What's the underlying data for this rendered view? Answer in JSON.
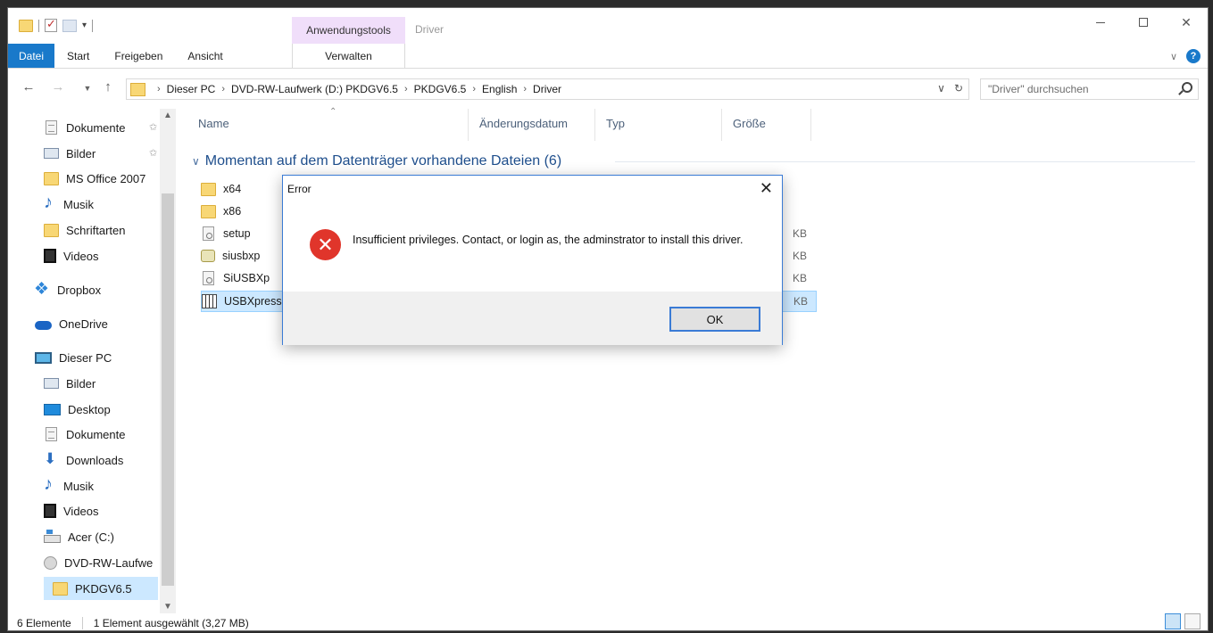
{
  "window": {
    "title": "Driver",
    "contextual_group": "Anwendungstools"
  },
  "ribbon": {
    "tabs": [
      "Datei",
      "Start",
      "Freigeben",
      "Ansicht"
    ],
    "context_tab": "Verwalten"
  },
  "address": {
    "crumbs": [
      "Dieser PC",
      "DVD-RW-Laufwerk (D:) PKDGV6.5",
      "PKDGV6.5",
      "English",
      "Driver"
    ]
  },
  "search": {
    "placeholder": "\"Driver\" durchsuchen"
  },
  "nav": {
    "items": [
      {
        "label": "Dokumente",
        "icon": "document-icon"
      },
      {
        "label": "Bilder",
        "icon": "pictures-icon"
      },
      {
        "label": "MS Office 2007",
        "icon": "folder-icon"
      },
      {
        "label": "Musik",
        "icon": "music-icon"
      },
      {
        "label": "Schriftarten",
        "icon": "folder-icon"
      },
      {
        "label": "Videos",
        "icon": "video-icon"
      },
      {
        "label": "Dropbox",
        "icon": "dropbox-icon"
      },
      {
        "label": "OneDrive",
        "icon": "onedrive-icon"
      },
      {
        "label": "Dieser PC",
        "icon": "pc-icon"
      },
      {
        "label": "Bilder",
        "icon": "pictures-icon"
      },
      {
        "label": "Desktop",
        "icon": "desktop-icon"
      },
      {
        "label": "Dokumente",
        "icon": "document-icon"
      },
      {
        "label": "Downloads",
        "icon": "download-icon"
      },
      {
        "label": "Musik",
        "icon": "music-icon"
      },
      {
        "label": "Videos",
        "icon": "video-icon"
      },
      {
        "label": "Acer (C:)",
        "icon": "drive-icon"
      },
      {
        "label": "DVD-RW-Laufwe",
        "icon": "disc-icon"
      },
      {
        "label": "PKDGV6.5",
        "icon": "folder-icon"
      }
    ]
  },
  "columns": [
    "Name",
    "Änderungsdatum",
    "Typ",
    "Größe"
  ],
  "group": {
    "label": "Momentan auf dem Datenträger vorhandene Dateien (6)"
  },
  "files": [
    {
      "name": "x64",
      "icon": "folder-icon",
      "size": ""
    },
    {
      "name": "x86",
      "icon": "folder-icon",
      "size": ""
    },
    {
      "name": "setup",
      "icon": "setup-file-icon",
      "size": "KB"
    },
    {
      "name": "siusbxp",
      "icon": "inf-file-icon",
      "size": "KB"
    },
    {
      "name": "SiUSBXp",
      "icon": "dll-file-icon",
      "size": "KB"
    },
    {
      "name": "USBXpressl",
      "icon": "installer-icon",
      "size": "KB"
    }
  ],
  "status": {
    "count": "6 Elemente",
    "selection": "1 Element ausgewählt (3,27 MB)"
  },
  "dialog": {
    "title": "Error",
    "message": "Insufficient privileges. Contact, or login as, the adminstrator to install this driver.",
    "ok_label": "OK"
  },
  "colors": {
    "file_tab": "#1979ca",
    "context_tab": "#f0defa",
    "selection": "#cce8ff",
    "error_red": "#e0352b",
    "dialog_border": "#3a7bd5"
  }
}
